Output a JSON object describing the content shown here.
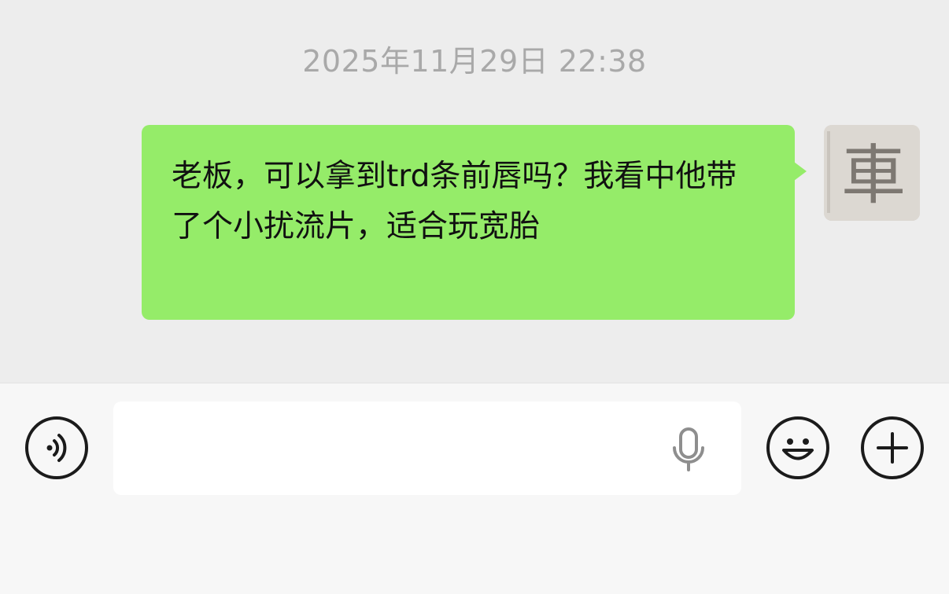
{
  "chat": {
    "timestamp": "2025年11月29日 22:38",
    "messages": [
      {
        "sender": "self",
        "text": "老板，可以拿到trd条前唇吗？我看中他带了个小扰流片，适合玩宽胎"
      }
    ],
    "avatar": {
      "icon": "avatar-image",
      "glyph": "車"
    }
  },
  "input_bar": {
    "voice_icon": "voice-mode-icon",
    "input_value": "",
    "mic_icon": "microphone-icon",
    "emoji_icon": "emoji-icon",
    "plus_icon": "plus-icon"
  },
  "colors": {
    "chat_background": "#ededed",
    "bubble_self": "#95ec69",
    "timestamp_text": "#a9a9a9",
    "input_bar_background": "#f7f7f7"
  }
}
